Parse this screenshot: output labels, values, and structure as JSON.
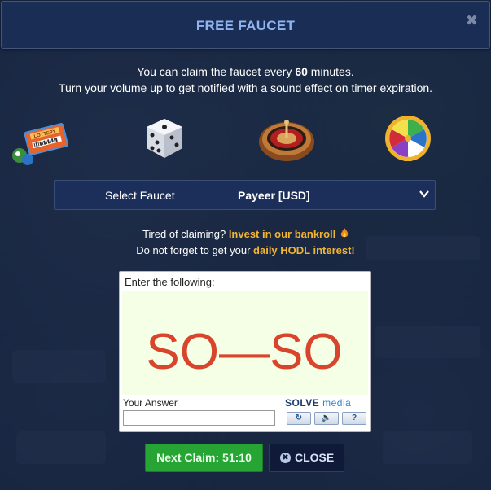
{
  "header": {
    "title": "FREE FAUCET",
    "close_glyph": "✖"
  },
  "info": {
    "line1_prefix": "You can claim the faucet every ",
    "minutes": "60",
    "line1_suffix": " minutes.",
    "line2": "Turn your volume up to get notified with a sound effect on timer expiration."
  },
  "games": [
    {
      "name": "lottery",
      "icon": "lottery-tickets-icon"
    },
    {
      "name": "dice",
      "icon": "dice-icon"
    },
    {
      "name": "roulette",
      "icon": "roulette-wheel-icon"
    },
    {
      "name": "wheel",
      "icon": "wheel-of-fortune-icon"
    }
  ],
  "faucet_select": {
    "label": "Select Faucet",
    "value": "Payeer [USD]"
  },
  "promo": {
    "line1_prefix": "Tired of claiming? ",
    "bankroll_link": "Invest in our bankroll",
    "line2_prefix": "Do not forget to get your ",
    "hodl_link": "daily HODL interest!",
    "flame_icon": "flame-icon"
  },
  "captcha": {
    "instruction": "Enter the following:",
    "challenge_text": "SO—SO",
    "answer_label": "Your Answer",
    "answer_value": "",
    "brand_solve": "SOLVE",
    "brand_media": " media",
    "buttons": [
      {
        "name": "refresh",
        "glyph": "↻",
        "icon": "refresh-icon"
      },
      {
        "name": "audio",
        "glyph": "🔈",
        "icon": "audio-icon"
      },
      {
        "name": "help",
        "glyph": "?",
        "icon": "help-icon"
      }
    ]
  },
  "footer": {
    "next_claim_label": "Next Claim: 51:10",
    "close_label": "CLOSE",
    "close_icon_glyph": "✖"
  },
  "colors": {
    "accent_gold": "#f2b531",
    "title_blue": "#8fb4f0",
    "claim_green": "#27a534",
    "captcha_red": "#d9442d"
  }
}
